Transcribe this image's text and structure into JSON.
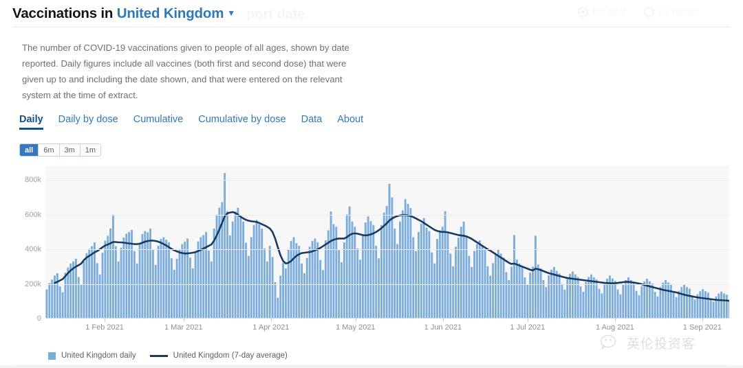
{
  "header": {
    "title_prefix": "Vaccinations in ",
    "location": "United Kingdom",
    "caret_icon": "chevron-down-icon",
    "ghost_text": "port date",
    "radios": [
      {
        "label": "UK total",
        "selected": true
      },
      {
        "label": "By nation",
        "selected": false
      }
    ]
  },
  "description": "The number of COVID-19 vaccinations given to people of all ages, shown by date reported. Daily figures include all vaccines (both first and second dose) that were given up to and including the date shown, and that were entered on the relevant system at the time of extract.",
  "tabs": [
    {
      "label": "Daily",
      "active": true
    },
    {
      "label": "Daily by dose",
      "active": false
    },
    {
      "label": "Cumulative",
      "active": false
    },
    {
      "label": "Cumulative by dose",
      "active": false
    },
    {
      "label": "Data",
      "active": false
    },
    {
      "label": "About",
      "active": false
    }
  ],
  "range_buttons": [
    {
      "label": "all",
      "active": true
    },
    {
      "label": "6m",
      "active": false
    },
    {
      "label": "3m",
      "active": false
    },
    {
      "label": "1m",
      "active": false
    }
  ],
  "legend": [
    {
      "label": "United Kingdom daily",
      "marker": "square",
      "color": "#7CACD9"
    },
    {
      "label": "United Kingdom (7-day average)",
      "marker": "line",
      "color": "#163a63"
    }
  ],
  "watermark": {
    "icon": "wechat-icon",
    "text": "英伦投资客"
  },
  "colors": {
    "bar": "#7CACD9",
    "average_line": "#163a63",
    "accent": "#2E79B8",
    "plot_background": "#f7f7f8"
  },
  "chart_data": {
    "type": "bar",
    "title": "Vaccinations in United Kingdom",
    "xlabel": "",
    "ylabel": "",
    "ylim": [
      0,
      880000
    ],
    "yticks": [
      0,
      200000,
      400000,
      600000,
      800000
    ],
    "ytick_labels": [
      "0",
      "200k",
      "400k",
      "600k",
      "800k"
    ],
    "grid": true,
    "legend_position": "bottom-left",
    "x_start": "2021-01-11",
    "x_end": "2021-09-12",
    "xtick_labels": [
      "1 Feb 2021",
      "1 Mar 2021",
      "1 Apr 2021",
      "1 May 2021",
      "1 Jun 2021",
      "1 Jul 2021",
      "1 Aug 2021",
      "1 Sep 2021"
    ],
    "xtick_dates": [
      "2021-02-01",
      "2021-03-01",
      "2021-04-01",
      "2021-05-01",
      "2021-06-01",
      "2021-07-01",
      "2021-08-01",
      "2021-09-01"
    ],
    "series": [
      {
        "name": "United Kingdom daily",
        "type": "bar",
        "color": "#7CACD9",
        "values": [
          168000,
          205000,
          225000,
          248000,
          262000,
          186000,
          152000,
          265000,
          295000,
          318000,
          330000,
          345000,
          240000,
          198000,
          330000,
          378000,
          402000,
          418000,
          440000,
          320000,
          255000,
          380000,
          450000,
          478000,
          520000,
          600000,
          418000,
          330000,
          410000,
          468000,
          490000,
          500000,
          512000,
          390000,
          318000,
          430000,
          488000,
          505000,
          498000,
          520000,
          400000,
          310000,
          420000,
          460000,
          470000,
          455000,
          440000,
          348000,
          282000,
          345000,
          400000,
          430000,
          445000,
          462000,
          352000,
          290000,
          380000,
          445000,
          470000,
          482000,
          500000,
          392000,
          330000,
          520000,
          600000,
          640000,
          672000,
          840000,
          620000,
          480000,
          560000,
          618000,
          640000,
          582000,
          560000,
          438000,
          362000,
          470000,
          540000,
          570000,
          545000,
          520000,
          405000,
          330000,
          420000,
          355000,
          210000,
          120000,
          248000,
          322000,
          290000,
          400000,
          448000,
          470000,
          435000,
          420000,
          318000,
          262000,
          350000,
          415000,
          448000,
          462000,
          440000,
          338000,
          280000,
          452000,
          510000,
          618000,
          545000,
          530000,
          395000,
          325000,
          440000,
          602000,
          648000,
          560000,
          530000,
          405000,
          340000,
          480000,
          555000,
          590000,
          562000,
          540000,
          420000,
          348000,
          540000,
          612000,
          650000,
          778000,
          700000,
          520000,
          430000,
          560000,
          625000,
          690000,
          662000,
          638000,
          470000,
          390000,
          500000,
          548000,
          580000,
          525000,
          505000,
          382000,
          318000,
          460000,
          510000,
          530000,
          620000,
          498000,
          375000,
          302000,
          415000,
          468000,
          530000,
          560000,
          480000,
          362000,
          298000,
          390000,
          430000,
          452000,
          420000,
          398000,
          302000,
          248000,
          320000,
          372000,
          398000,
          375000,
          352000,
          268000,
          222000,
          300000,
          482000,
          340000,
          318000,
          302000,
          238000,
          195000,
          265000,
          300000,
          478000,
          312000,
          290000,
          222000,
          182000,
          250000,
          282000,
          298000,
          275000,
          260000,
          200000,
          168000,
          228000,
          258000,
          272000,
          255000,
          240000,
          186000,
          155000,
          212000,
          240000,
          255000,
          238000,
          225000,
          172000,
          145000,
          200000,
          230000,
          248000,
          232000,
          218000,
          168000,
          140000,
          195000,
          222000,
          238000,
          222000,
          210000,
          160000,
          134000,
          188000,
          215000,
          230000,
          215000,
          202000,
          155000,
          128000,
          182000,
          208000,
          222000,
          208000,
          196000,
          150000,
          124000,
          160000,
          182000,
          195000,
          182000,
          172000,
          132000,
          110000,
          140000,
          158000,
          170000,
          158000,
          150000,
          115000,
          98000,
          128000,
          145000,
          156000,
          145000,
          138000,
          106000,
          90000
        ]
      },
      {
        "name": "United Kingdom (7-day average)",
        "type": "line",
        "color": "#163a63",
        "values": [
          null,
          null,
          null,
          206000,
          212000,
          220000,
          228000,
          245000,
          262000,
          278000,
          290000,
          300000,
          308000,
          318000,
          338000,
          352000,
          362000,
          372000,
          382000,
          390000,
          400000,
          412000,
          422000,
          428000,
          435000,
          442000,
          442000,
          440000,
          440000,
          438000,
          436000,
          434000,
          432000,
          430000,
          430000,
          432000,
          438000,
          444000,
          448000,
          450000,
          450000,
          448000,
          444000,
          438000,
          430000,
          422000,
          412000,
          402000,
          394000,
          388000,
          382000,
          378000,
          376000,
          376000,
          378000,
          380000,
          384000,
          390000,
          396000,
          404000,
          412000,
          420000,
          428000,
          450000,
          480000,
          515000,
          552000,
          590000,
          608000,
          612000,
          615000,
          610000,
          600000,
          588000,
          578000,
          570000,
          565000,
          562000,
          560000,
          558000,
          552000,
          545000,
          538000,
          530000,
          520000,
          500000,
          462000,
          412000,
          365000,
          332000,
          318000,
          322000,
          332000,
          348000,
          362000,
          372000,
          378000,
          380000,
          382000,
          384000,
          388000,
          394000,
          400000,
          408000,
          418000,
          428000,
          438000,
          448000,
          455000,
          460000,
          462000,
          462000,
          462000,
          470000,
          482000,
          490000,
          492000,
          490000,
          486000,
          482000,
          480000,
          482000,
          486000,
          492000,
          500000,
          510000,
          522000,
          536000,
          550000,
          566000,
          578000,
          586000,
          592000,
          596000,
          598000,
          598000,
          596000,
          592000,
          586000,
          578000,
          570000,
          562000,
          552000,
          542000,
          532000,
          522000,
          512000,
          506000,
          502000,
          500000,
          500000,
          498000,
          494000,
          490000,
          486000,
          482000,
          480000,
          478000,
          474000,
          468000,
          460000,
          450000,
          440000,
          430000,
          420000,
          410000,
          400000,
          392000,
          382000,
          372000,
          362000,
          352000,
          342000,
          332000,
          322000,
          315000,
          318000,
          312000,
          306000,
          300000,
          294000,
          288000,
          282000,
          278000,
          288000,
          285000,
          280000,
          274000,
          268000,
          262000,
          258000,
          254000,
          250000,
          246000,
          242000,
          238000,
          234000,
          232000,
          230000,
          228000,
          226000,
          224000,
          222000,
          220000,
          218000,
          216000,
          214000,
          212000,
          210000,
          208000,
          206000,
          205000,
          204000,
          204000,
          204000,
          206000,
          208000,
          210000,
          212000,
          212000,
          210000,
          208000,
          205000,
          202000,
          198000,
          194000,
          190000,
          186000,
          182000,
          178000,
          174000,
          170000,
          166000,
          163000,
          160000,
          157000,
          154000,
          151000,
          146000,
          142000,
          138000,
          134000,
          131000,
          128000,
          125000,
          122000,
          120000,
          118000,
          116000,
          114000,
          112000,
          110000,
          108000,
          107000,
          106000,
          105000,
          104000,
          103000,
          102000
        ]
      }
    ]
  }
}
